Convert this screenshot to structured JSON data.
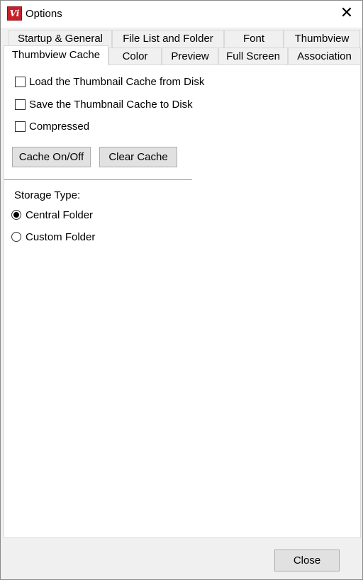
{
  "window": {
    "title": "Options",
    "app_icon_text": "Vi",
    "close_glyph": "✕"
  },
  "tabs": {
    "row_back": [
      {
        "label": "Startup & General"
      },
      {
        "label": "File List and Folder"
      },
      {
        "label": "Font"
      },
      {
        "label": "Thumbview"
      }
    ],
    "row_front": [
      {
        "label": "Thumbview Cache",
        "selected": true
      },
      {
        "label": "Color"
      },
      {
        "label": "Preview"
      },
      {
        "label": "Full Screen"
      },
      {
        "label": "Association"
      }
    ]
  },
  "panel": {
    "checkboxes": [
      {
        "label": "Load the Thumbnail Cache from Disk",
        "checked": false
      },
      {
        "label": "Save the Thumbnail Cache to Disk",
        "checked": false
      },
      {
        "label": "Compressed",
        "checked": false
      }
    ],
    "buttons": {
      "cache_toggle": "Cache On/Off",
      "clear_cache": "Clear Cache"
    },
    "storage_type": {
      "label": "Storage Type:",
      "options": [
        {
          "label": "Central Folder",
          "selected": true
        },
        {
          "label": "Custom Folder",
          "selected": false
        }
      ]
    }
  },
  "footer": {
    "close_button": "Close"
  }
}
